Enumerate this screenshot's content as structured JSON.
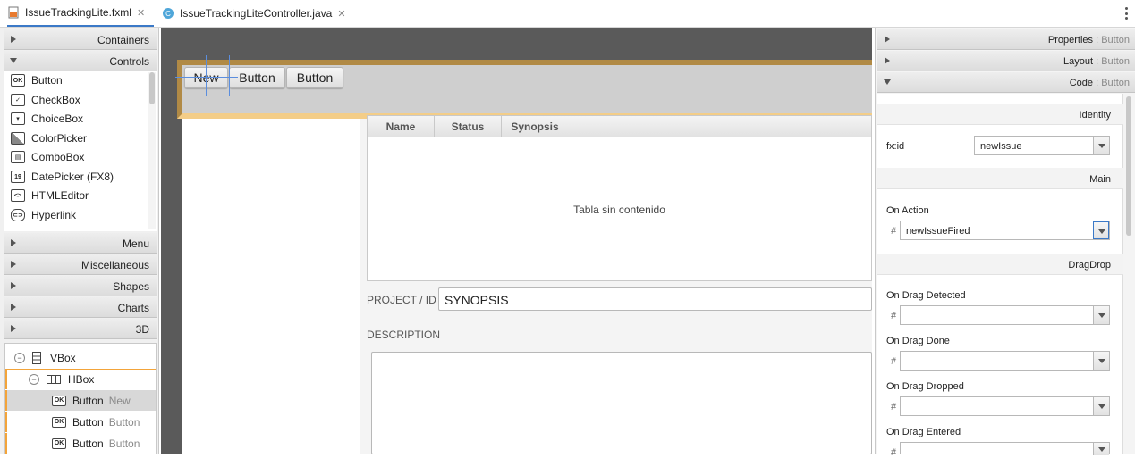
{
  "tabs": [
    {
      "label": "IssueTrackingLite.fxml",
      "icon": "fxml-file-icon"
    },
    {
      "label": "IssueTrackingLiteController.java",
      "icon": "java-class-icon"
    }
  ],
  "library": {
    "containers_label": "Containers",
    "controls_label": "Controls",
    "controls": [
      "Button",
      "CheckBox",
      "ChoiceBox",
      "ColorPicker",
      "ComboBox",
      "DatePicker  (FX8)",
      "HTMLEditor",
      "Hyperlink"
    ],
    "sections": [
      "Menu",
      "Miscellaneous",
      "Shapes",
      "Charts",
      "3D"
    ]
  },
  "hierarchy": [
    {
      "type": "VBox",
      "sub": ""
    },
    {
      "type": "HBox",
      "sub": ""
    },
    {
      "type": "Button",
      "sub": "New"
    },
    {
      "type": "Button",
      "sub": "Button"
    },
    {
      "type": "Button",
      "sub": "Button"
    }
  ],
  "design": {
    "buttons": [
      "New",
      "Button",
      "Button"
    ],
    "columns": [
      "Name",
      "Status",
      "Synopsis"
    ],
    "empty_table": "Tabla sin contenido",
    "project_label": "PROJECT / ID",
    "synopsis_value": "SYNOPSIS",
    "description_label": "DESCRIPTION"
  },
  "inspector": {
    "properties": {
      "title": "Properties",
      "sep": " : ",
      "sub": "Button"
    },
    "layout": {
      "title": "Layout",
      "sep": " : ",
      "sub": "Button"
    },
    "code": {
      "title": "Code",
      "sep": " : ",
      "sub": "Button"
    },
    "identity_label": "Identity",
    "fxid_label": "fx:id",
    "fxid_value": "newIssue",
    "main_label": "Main",
    "on_action_label": "On Action",
    "on_action_value": "newIssueFired",
    "dragdrop_label": "DragDrop",
    "hash": "#",
    "drag_fields": [
      "On Drag Detected",
      "On Drag Done",
      "On Drag Dropped",
      "On Drag Entered"
    ]
  },
  "colors": {
    "accent": "#3b79c7",
    "hbox_border": "#b18a45",
    "hbox_bottom": "#f3cd88"
  }
}
